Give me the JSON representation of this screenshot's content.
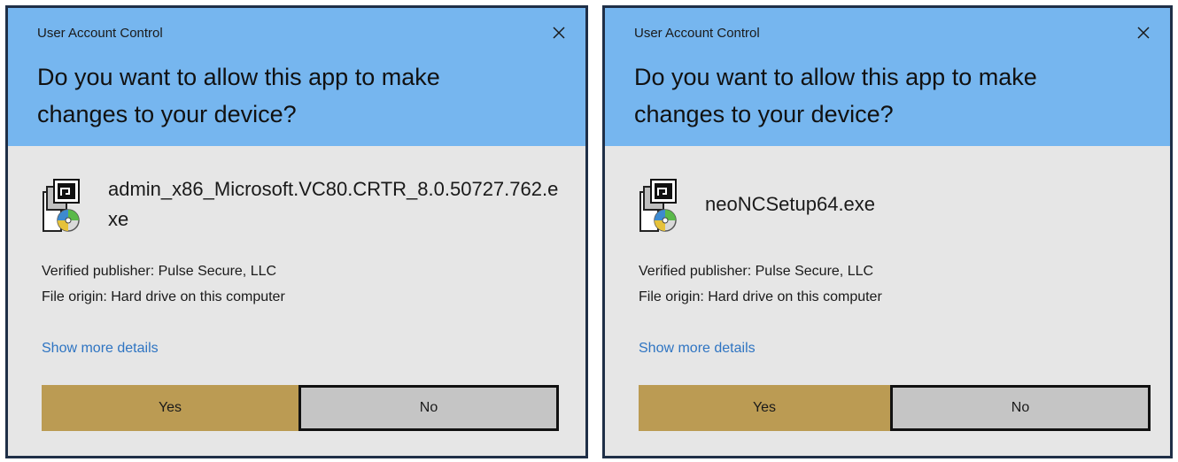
{
  "dialogs": [
    {
      "window_title": "User Account Control",
      "close_icon": "close-icon",
      "question": "Do you want to allow this app to make changes to your device?",
      "app_icon": "installer-icon",
      "app_name": "admin_x86_Microsoft.VC80.CRTR_8.0.50727.762.exe",
      "publisher": "Verified publisher: Pulse Secure, LLC",
      "origin": "File origin: Hard drive on this computer",
      "more_details": "Show more details",
      "yes_label": "Yes",
      "no_label": "No"
    },
    {
      "window_title": "User Account Control",
      "close_icon": "close-icon",
      "question": "Do you want to allow this app to make changes to your device?",
      "app_icon": "installer-icon",
      "app_name": "neoNCSetup64.exe",
      "publisher": "Verified publisher: Pulse Secure, LLC",
      "origin": "File origin: Hard drive on this computer",
      "more_details": "Show more details",
      "yes_label": "Yes",
      "no_label": "No"
    }
  ],
  "colors": {
    "header": "#76b6ef",
    "body": "#e6e6e6",
    "yes_button": "#bb9b53",
    "no_button": "#c5c5c5",
    "link": "#2e74c2"
  }
}
